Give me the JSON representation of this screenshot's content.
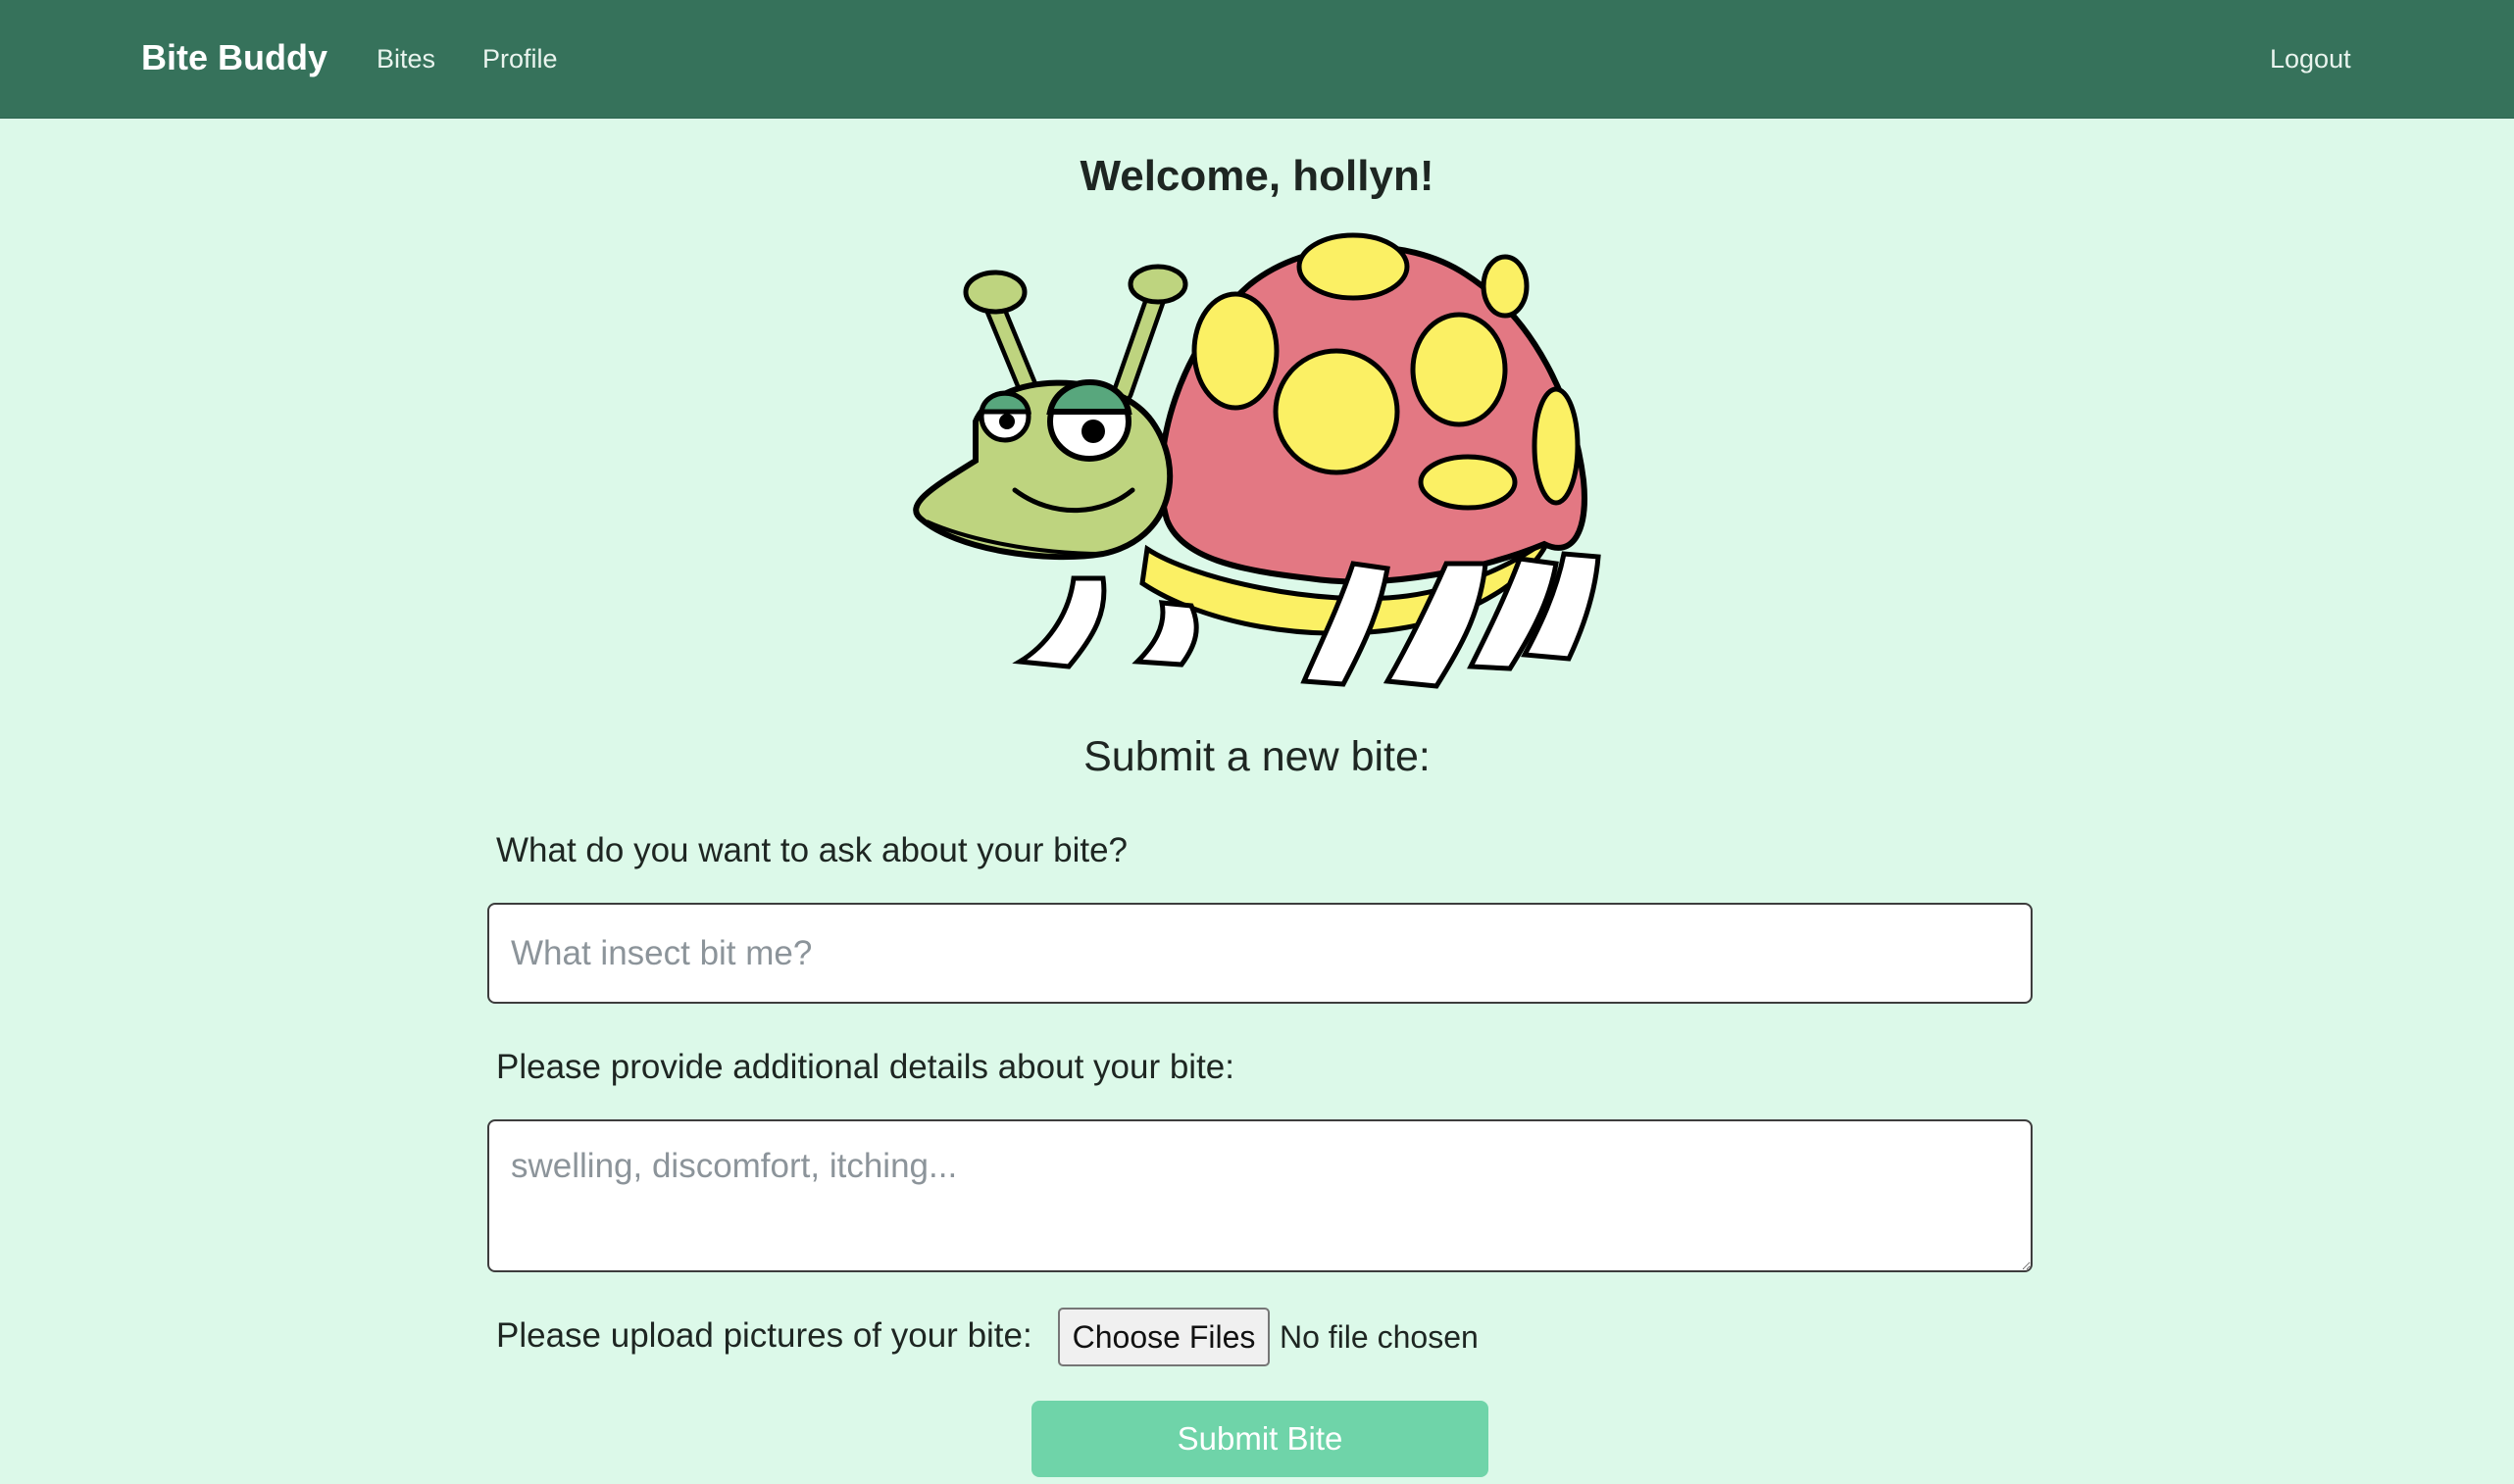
{
  "navbar": {
    "brand": "Bite Buddy",
    "links": [
      {
        "label": "Bites"
      },
      {
        "label": "Profile"
      }
    ],
    "logout_label": "Logout"
  },
  "main": {
    "welcome": "Welcome, hollyn!",
    "mascot_icon": "ladybug-mascot-illustration",
    "submit_heading": "Submit a new bite:",
    "question": {
      "label": "What do you want to ask about your bite?",
      "placeholder": "What insect bit me?",
      "value": ""
    },
    "details": {
      "label": "Please provide additional details about your bite:",
      "placeholder": "swelling, discomfort, itching...",
      "value": ""
    },
    "upload": {
      "label": "Please upload pictures of your bite:",
      "button_label": "Choose Files",
      "status": "No file chosen"
    },
    "submit_label": "Submit Bite"
  },
  "colors": {
    "navbar": "#36725b",
    "background": "#dcf9e9",
    "submit_button": "#6fd4a9",
    "shell": "#e37883",
    "spots": "#fbf064",
    "body": "#bed47f"
  }
}
